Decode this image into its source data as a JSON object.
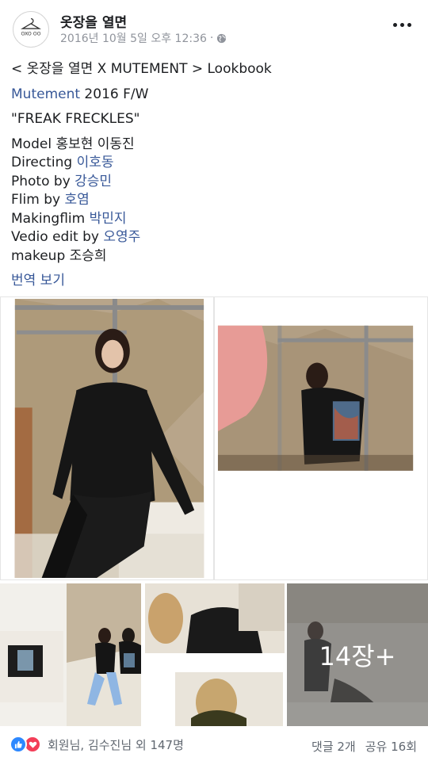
{
  "post": {
    "page_name": "옷장을 열면",
    "timestamp": "2016년 10월 5일 오후 12:36",
    "separator": "·",
    "logo_text": "OXO OO",
    "lines": {
      "title": "< 옷장을 열면 X MUTEMENT > Lookbook",
      "brand": "Mutement",
      "season": " 2016 F/W",
      "quote": "\"FREAK FRECKLES\"",
      "model_label": "Model 홍보현 이동진",
      "directing_label": "Directing ",
      "directing_name": "이호동",
      "photo_label": "Photo by ",
      "photo_name": "강승민",
      "flim_label": "Flim by ",
      "flim_name": "호염",
      "making_label": "Makingflim ",
      "making_name": "박민지",
      "video_label": "Vedio edit by ",
      "video_name": "오영주",
      "makeup_label": "makeup 조승희"
    },
    "translate": "번역 보기",
    "more_photos": "14장+"
  },
  "footer": {
    "reactors": "회원님, 김수진님 외 147명",
    "comments": "댓글 2개",
    "shares": "공유 16회"
  },
  "icons": {
    "more": "more-options-icon",
    "globe": "globe-icon",
    "like": "like-reaction-icon",
    "love": "love-reaction-icon"
  },
  "colors": {
    "link": "#385898",
    "meta": "#90949c",
    "like": "#2d88ff",
    "love": "#f33e58"
  }
}
